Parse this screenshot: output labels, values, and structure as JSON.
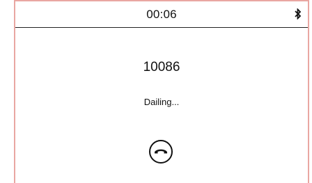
{
  "status_bar": {
    "time": "00:06",
    "bluetooth_icon": "bluetooth-icon"
  },
  "call": {
    "number": "10086",
    "status": "Dailing..."
  },
  "actions": {
    "hangup_icon": "phone-hangup-icon"
  },
  "colors": {
    "frame_border": "#e9a7a2",
    "text": "#111111",
    "background": "#ffffff"
  }
}
